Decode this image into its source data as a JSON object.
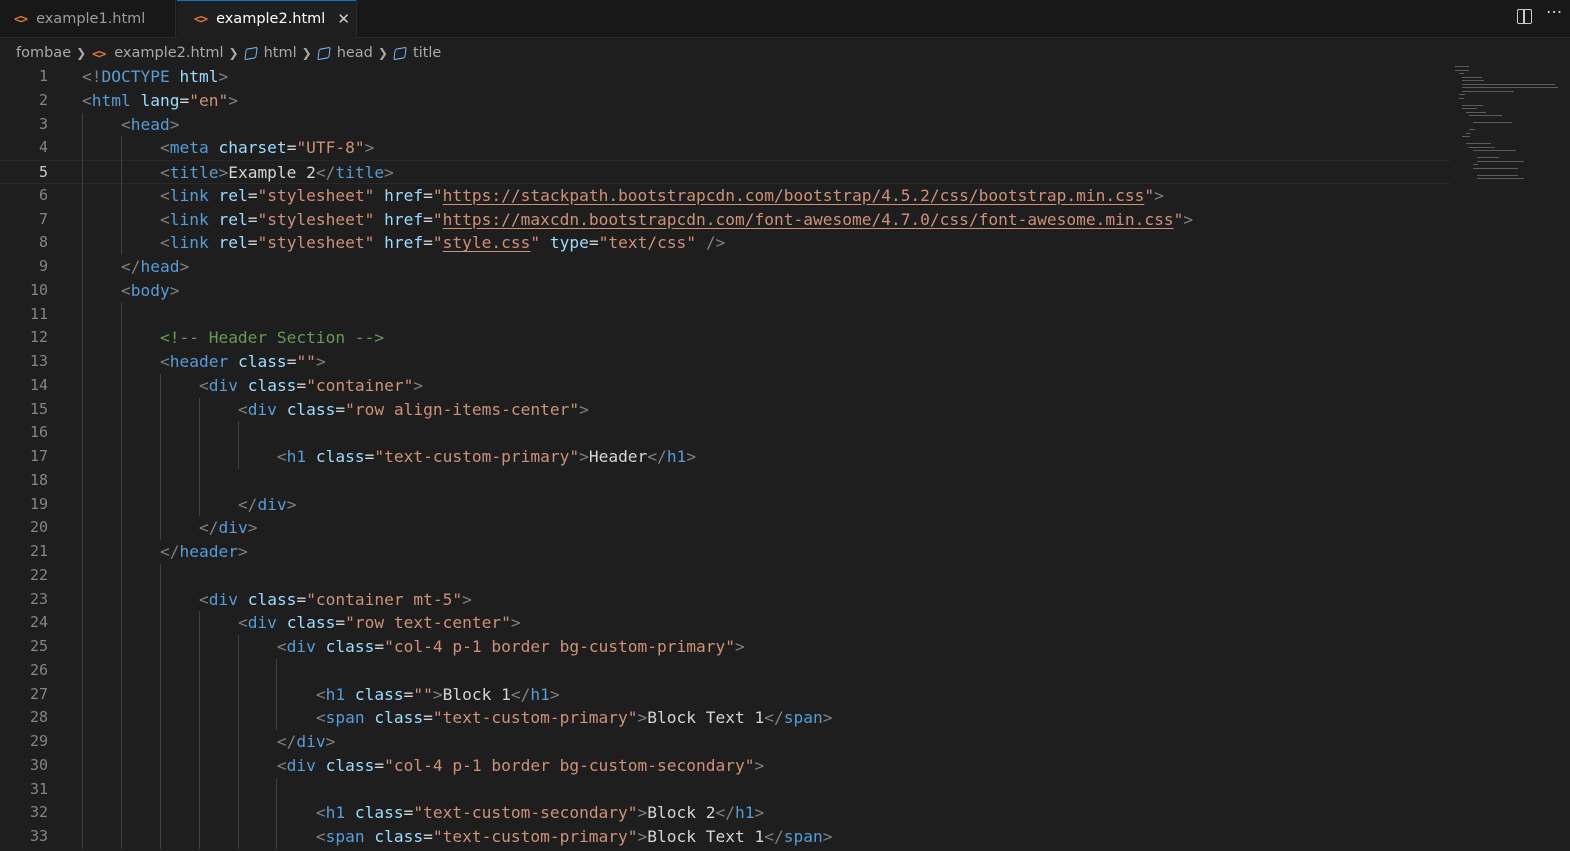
{
  "tabs": [
    {
      "label": "example1.html",
      "icon": "html-file-icon",
      "active": false
    },
    {
      "label": "example2.html",
      "icon": "html-file-icon",
      "active": true
    }
  ],
  "tab_icons": {
    "file_glyph": "<>",
    "close_glyph": "✕",
    "more_glyph": "···"
  },
  "breadcrumbs": [
    "fombae",
    "example2.html",
    "html",
    "head",
    "title"
  ],
  "colors": {
    "tag": "#569cd6",
    "attribute": "#9cdcfe",
    "string": "#ce9178",
    "text": "#d4d4d4",
    "comment": "#6a9955",
    "punctuation": "#808080",
    "accent": "#0078d4"
  },
  "active_line": 5,
  "lines": [
    {
      "n": "1",
      "s": [
        [
          "tp",
          "<!"
        ],
        [
          "tg",
          "DOCTYPE"
        ],
        [
          "tx",
          " "
        ],
        [
          "at",
          "html"
        ],
        [
          "tp",
          ">"
        ]
      ]
    },
    {
      "n": "2",
      "s": [
        [
          "tp",
          "<"
        ],
        [
          "tg",
          "html"
        ],
        [
          "tx",
          " "
        ],
        [
          "at",
          "lang"
        ],
        [
          "tx",
          "="
        ],
        [
          "av",
          "\"en\""
        ],
        [
          "tp",
          ">"
        ]
      ]
    },
    {
      "n": "3",
      "s": [
        [
          "tx",
          "    "
        ],
        [
          "tp",
          "<"
        ],
        [
          "tg",
          "head"
        ],
        [
          "tp",
          ">"
        ]
      ]
    },
    {
      "n": "4",
      "s": [
        [
          "tx",
          "        "
        ],
        [
          "tp",
          "<"
        ],
        [
          "tg",
          "meta"
        ],
        [
          "tx",
          " "
        ],
        [
          "at",
          "charset"
        ],
        [
          "tx",
          "="
        ],
        [
          "av",
          "\"UTF-8\""
        ],
        [
          "tp",
          ">"
        ]
      ]
    },
    {
      "n": "5",
      "s": [
        [
          "tx",
          "        "
        ],
        [
          "tp",
          "<"
        ],
        [
          "tg",
          "title"
        ],
        [
          "tp",
          ">"
        ],
        [
          "tx",
          "Example 2"
        ],
        [
          "tp",
          "</"
        ],
        [
          "tg",
          "title"
        ],
        [
          "tp",
          ">"
        ]
      ]
    },
    {
      "n": "6",
      "s": [
        [
          "tx",
          "        "
        ],
        [
          "tp",
          "<"
        ],
        [
          "tg",
          "link"
        ],
        [
          "tx",
          " "
        ],
        [
          "at",
          "rel"
        ],
        [
          "tx",
          "="
        ],
        [
          "av",
          "\"stylesheet\""
        ],
        [
          "tx",
          " "
        ],
        [
          "at",
          "href"
        ],
        [
          "tx",
          "="
        ],
        [
          "av",
          "\""
        ],
        [
          "avu",
          "https://stackpath.bootstrapcdn.com/bootstrap/4.5.2/css/bootstrap.min.css"
        ],
        [
          "av",
          "\""
        ],
        [
          "tp",
          ">"
        ]
      ]
    },
    {
      "n": "7",
      "s": [
        [
          "tx",
          "        "
        ],
        [
          "tp",
          "<"
        ],
        [
          "tg",
          "link"
        ],
        [
          "tx",
          " "
        ],
        [
          "at",
          "rel"
        ],
        [
          "tx",
          "="
        ],
        [
          "av",
          "\"stylesheet\""
        ],
        [
          "tx",
          " "
        ],
        [
          "at",
          "href"
        ],
        [
          "tx",
          "="
        ],
        [
          "av",
          "\""
        ],
        [
          "avu",
          "https://maxcdn.bootstrapcdn.com/font-awesome/4.7.0/css/font-awesome.min.css"
        ],
        [
          "av",
          "\""
        ],
        [
          "tp",
          ">"
        ]
      ]
    },
    {
      "n": "8",
      "s": [
        [
          "tx",
          "        "
        ],
        [
          "tp",
          "<"
        ],
        [
          "tg",
          "link"
        ],
        [
          "tx",
          " "
        ],
        [
          "at",
          "rel"
        ],
        [
          "tx",
          "="
        ],
        [
          "av",
          "\"stylesheet\""
        ],
        [
          "tx",
          " "
        ],
        [
          "at",
          "href"
        ],
        [
          "tx",
          "="
        ],
        [
          "av",
          "\""
        ],
        [
          "avu",
          "style.css"
        ],
        [
          "av",
          "\""
        ],
        [
          "tx",
          " "
        ],
        [
          "at",
          "type"
        ],
        [
          "tx",
          "="
        ],
        [
          "av",
          "\"text/css\""
        ],
        [
          "tx",
          " "
        ],
        [
          "tp",
          "/>"
        ]
      ]
    },
    {
      "n": "9",
      "s": [
        [
          "tx",
          "    "
        ],
        [
          "tp",
          "</"
        ],
        [
          "tg",
          "head"
        ],
        [
          "tp",
          ">"
        ]
      ]
    },
    {
      "n": "10",
      "s": [
        [
          "tx",
          "    "
        ],
        [
          "tp",
          "<"
        ],
        [
          "tg",
          "body"
        ],
        [
          "tp",
          ">"
        ]
      ]
    },
    {
      "n": "11",
      "s": []
    },
    {
      "n": "12",
      "s": [
        [
          "tx",
          "        "
        ],
        [
          "cm",
          "<!-- Header Section -->"
        ]
      ]
    },
    {
      "n": "13",
      "s": [
        [
          "tx",
          "        "
        ],
        [
          "tp",
          "<"
        ],
        [
          "tg",
          "header"
        ],
        [
          "tx",
          " "
        ],
        [
          "at",
          "class"
        ],
        [
          "tx",
          "="
        ],
        [
          "av",
          "\"\""
        ],
        [
          "tp",
          ">"
        ]
      ]
    },
    {
      "n": "14",
      "s": [
        [
          "tx",
          "            "
        ],
        [
          "tp",
          "<"
        ],
        [
          "tg",
          "div"
        ],
        [
          "tx",
          " "
        ],
        [
          "at",
          "class"
        ],
        [
          "tx",
          "="
        ],
        [
          "av",
          "\"container\""
        ],
        [
          "tp",
          ">"
        ]
      ]
    },
    {
      "n": "15",
      "s": [
        [
          "tx",
          "                "
        ],
        [
          "tp",
          "<"
        ],
        [
          "tg",
          "div"
        ],
        [
          "tx",
          " "
        ],
        [
          "at",
          "class"
        ],
        [
          "tx",
          "="
        ],
        [
          "av",
          "\"row align-items-center\""
        ],
        [
          "tp",
          ">"
        ]
      ]
    },
    {
      "n": "16",
      "s": []
    },
    {
      "n": "17",
      "s": [
        [
          "tx",
          "                    "
        ],
        [
          "tp",
          "<"
        ],
        [
          "tg",
          "h1"
        ],
        [
          "tx",
          " "
        ],
        [
          "at",
          "class"
        ],
        [
          "tx",
          "="
        ],
        [
          "av",
          "\"text-custom-primary\""
        ],
        [
          "tp",
          ">"
        ],
        [
          "tx",
          "Header"
        ],
        [
          "tp",
          "</"
        ],
        [
          "tg",
          "h1"
        ],
        [
          "tp",
          ">"
        ]
      ]
    },
    {
      "n": "18",
      "s": []
    },
    {
      "n": "19",
      "s": [
        [
          "tx",
          "                "
        ],
        [
          "tp",
          "</"
        ],
        [
          "tg",
          "div"
        ],
        [
          "tp",
          ">"
        ]
      ]
    },
    {
      "n": "20",
      "s": [
        [
          "tx",
          "            "
        ],
        [
          "tp",
          "</"
        ],
        [
          "tg",
          "div"
        ],
        [
          "tp",
          ">"
        ]
      ]
    },
    {
      "n": "21",
      "s": [
        [
          "tx",
          "        "
        ],
        [
          "tp",
          "</"
        ],
        [
          "tg",
          "header"
        ],
        [
          "tp",
          ">"
        ]
      ]
    },
    {
      "n": "22",
      "s": []
    },
    {
      "n": "23",
      "s": [
        [
          "tx",
          "            "
        ],
        [
          "tp",
          "<"
        ],
        [
          "tg",
          "div"
        ],
        [
          "tx",
          " "
        ],
        [
          "at",
          "class"
        ],
        [
          "tx",
          "="
        ],
        [
          "av",
          "\"container mt-5\""
        ],
        [
          "tp",
          ">"
        ]
      ]
    },
    {
      "n": "24",
      "s": [
        [
          "tx",
          "                "
        ],
        [
          "tp",
          "<"
        ],
        [
          "tg",
          "div"
        ],
        [
          "tx",
          " "
        ],
        [
          "at",
          "class"
        ],
        [
          "tx",
          "="
        ],
        [
          "av",
          "\"row text-center\""
        ],
        [
          "tp",
          ">"
        ]
      ]
    },
    {
      "n": "25",
      "s": [
        [
          "tx",
          "                    "
        ],
        [
          "tp",
          "<"
        ],
        [
          "tg",
          "div"
        ],
        [
          "tx",
          " "
        ],
        [
          "at",
          "class"
        ],
        [
          "tx",
          "="
        ],
        [
          "av",
          "\"col-4 p-1 border bg-custom-primary\""
        ],
        [
          "tp",
          ">"
        ]
      ]
    },
    {
      "n": "26",
      "s": []
    },
    {
      "n": "27",
      "s": [
        [
          "tx",
          "                        "
        ],
        [
          "tp",
          "<"
        ],
        [
          "tg",
          "h1"
        ],
        [
          "tx",
          " "
        ],
        [
          "at",
          "class"
        ],
        [
          "tx",
          "="
        ],
        [
          "av",
          "\"\""
        ],
        [
          "tp",
          ">"
        ],
        [
          "tx",
          "Block 1"
        ],
        [
          "tp",
          "</"
        ],
        [
          "tg",
          "h1"
        ],
        [
          "tp",
          ">"
        ]
      ]
    },
    {
      "n": "28",
      "s": [
        [
          "tx",
          "                        "
        ],
        [
          "tp",
          "<"
        ],
        [
          "tg",
          "span"
        ],
        [
          "tx",
          " "
        ],
        [
          "at",
          "class"
        ],
        [
          "tx",
          "="
        ],
        [
          "av",
          "\"text-custom-primary\""
        ],
        [
          "tp",
          ">"
        ],
        [
          "tx",
          "Block Text 1"
        ],
        [
          "tp",
          "</"
        ],
        [
          "tg",
          "span"
        ],
        [
          "tp",
          ">"
        ]
      ]
    },
    {
      "n": "29",
      "s": [
        [
          "tx",
          "                    "
        ],
        [
          "tp",
          "</"
        ],
        [
          "tg",
          "div"
        ],
        [
          "tp",
          ">"
        ]
      ]
    },
    {
      "n": "30",
      "s": [
        [
          "tx",
          "                    "
        ],
        [
          "tp",
          "<"
        ],
        [
          "tg",
          "div"
        ],
        [
          "tx",
          " "
        ],
        [
          "at",
          "class"
        ],
        [
          "tx",
          "="
        ],
        [
          "av",
          "\"col-4 p-1 border bg-custom-secondary\""
        ],
        [
          "tp",
          ">"
        ]
      ]
    },
    {
      "n": "31",
      "s": []
    },
    {
      "n": "32",
      "s": [
        [
          "tx",
          "                        "
        ],
        [
          "tp",
          "<"
        ],
        [
          "tg",
          "h1"
        ],
        [
          "tx",
          " "
        ],
        [
          "at",
          "class"
        ],
        [
          "tx",
          "="
        ],
        [
          "av",
          "\"text-custom-secondary\""
        ],
        [
          "tp",
          ">"
        ],
        [
          "tx",
          "Block 2"
        ],
        [
          "tp",
          "</"
        ],
        [
          "tg",
          "h1"
        ],
        [
          "tp",
          ">"
        ]
      ]
    },
    {
      "n": "33",
      "s": [
        [
          "tx",
          "                        "
        ],
        [
          "tp",
          "<"
        ],
        [
          "tg",
          "span"
        ],
        [
          "tx",
          " "
        ],
        [
          "at",
          "class"
        ],
        [
          "tx",
          "="
        ],
        [
          "av",
          "\"text-custom-primary\""
        ],
        [
          "tp",
          ">"
        ],
        [
          "tx",
          "Block Text 1"
        ],
        [
          "tp",
          "</"
        ],
        [
          "tg",
          "span"
        ],
        [
          "tp",
          ">"
        ]
      ]
    }
  ]
}
